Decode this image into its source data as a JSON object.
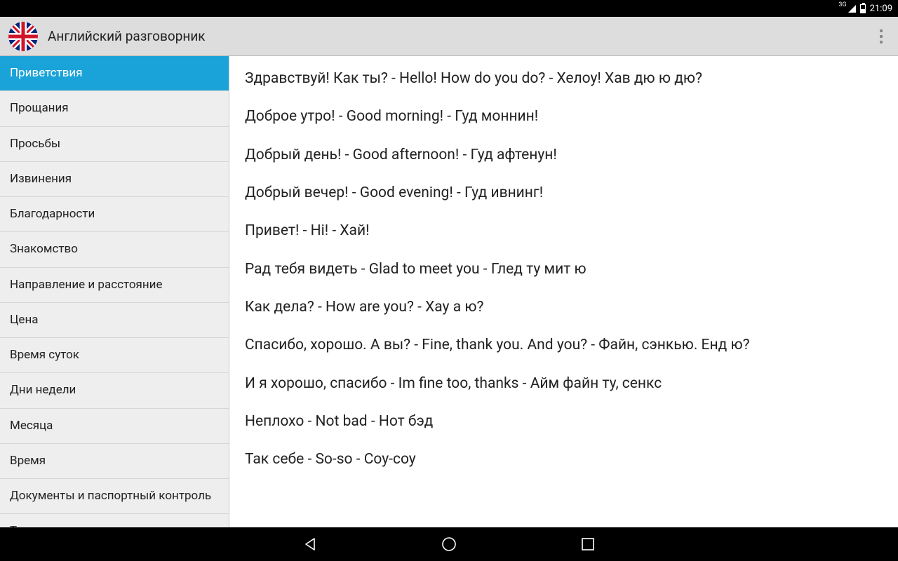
{
  "statusbar": {
    "network_label": "3G",
    "time": "21:09"
  },
  "appbar": {
    "title": "Английский разговорник"
  },
  "sidebar": {
    "selected_index": 0,
    "items": [
      "Приветствия",
      "Прощания",
      "Просьбы",
      "Извинения",
      "Благодарности",
      "Знакомство",
      "Направление и расстояние",
      "Цена",
      "Время суток",
      "Дни недели",
      "Месяца",
      "Время",
      "Документы и паспортный контроль",
      "Таможня"
    ]
  },
  "phrases": [
    "Здравствуй! Как ты? - Hello! How do you do? - Хелоу! Хав дю ю дю?",
    "Доброе утро! - Good morning! - Гуд моннин!",
    "Добрый день! - Good afternoon! - Гуд афтенун!",
    "Добрый вечер! - Good evening! - Гуд ивнинг!",
    "Привет! - Hi! - Хай!",
    "Рад тебя видеть - Glad to meet you - Глед ту мит ю",
    "Как дела? - How are you? - Хау а ю?",
    "Спасибо, хорошо. А вы? - Fine, thank you. And you? - Файн, сэнкью. Енд ю?",
    "И я хорошо, спасибо - Im fine too, thanks - Айм файн ту, сенкс",
    "Неплохо - Not bad - Нот бэд",
    "Так себе - So-so - Соу-соу"
  ]
}
